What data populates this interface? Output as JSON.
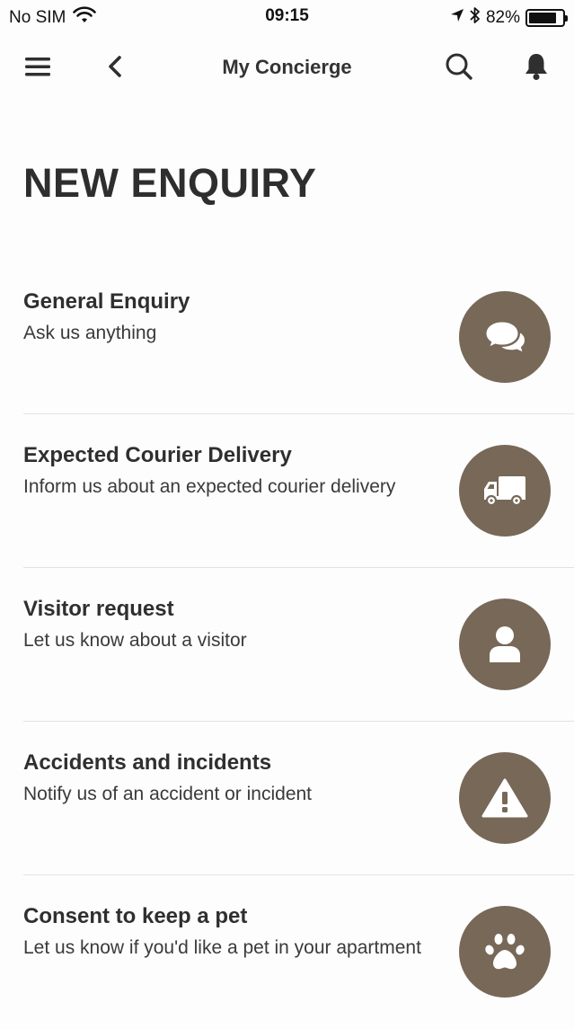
{
  "status_bar": {
    "carrier": "No SIM",
    "time": "09:15",
    "battery_percent": "82%",
    "battery_level": 0.82
  },
  "nav": {
    "title": "My Concierge",
    "icons": [
      "menu-icon",
      "back-icon",
      "search-icon",
      "bell-icon"
    ]
  },
  "page": {
    "title": "NEW ENQUIRY"
  },
  "items": [
    {
      "title": "General Enquiry",
      "subtitle": "Ask us anything",
      "icon": "chat-bubbles-icon"
    },
    {
      "title": "Expected Courier Delivery",
      "subtitle": "Inform us about an expected courier delivery",
      "icon": "truck-icon"
    },
    {
      "title": "Visitor request",
      "subtitle": "Let us know about a visitor",
      "icon": "person-icon"
    },
    {
      "title": "Accidents and incidents",
      "subtitle": "Notify us of an accident or incident",
      "icon": "warning-icon"
    },
    {
      "title": "Consent to keep a pet",
      "subtitle": "Let us know if you'd like a pet in your apartment",
      "icon": "paw-icon"
    }
  ],
  "colors": {
    "icon_circle": "#776858",
    "text": "#2f2f2f",
    "divider": "#e2e2e2"
  }
}
